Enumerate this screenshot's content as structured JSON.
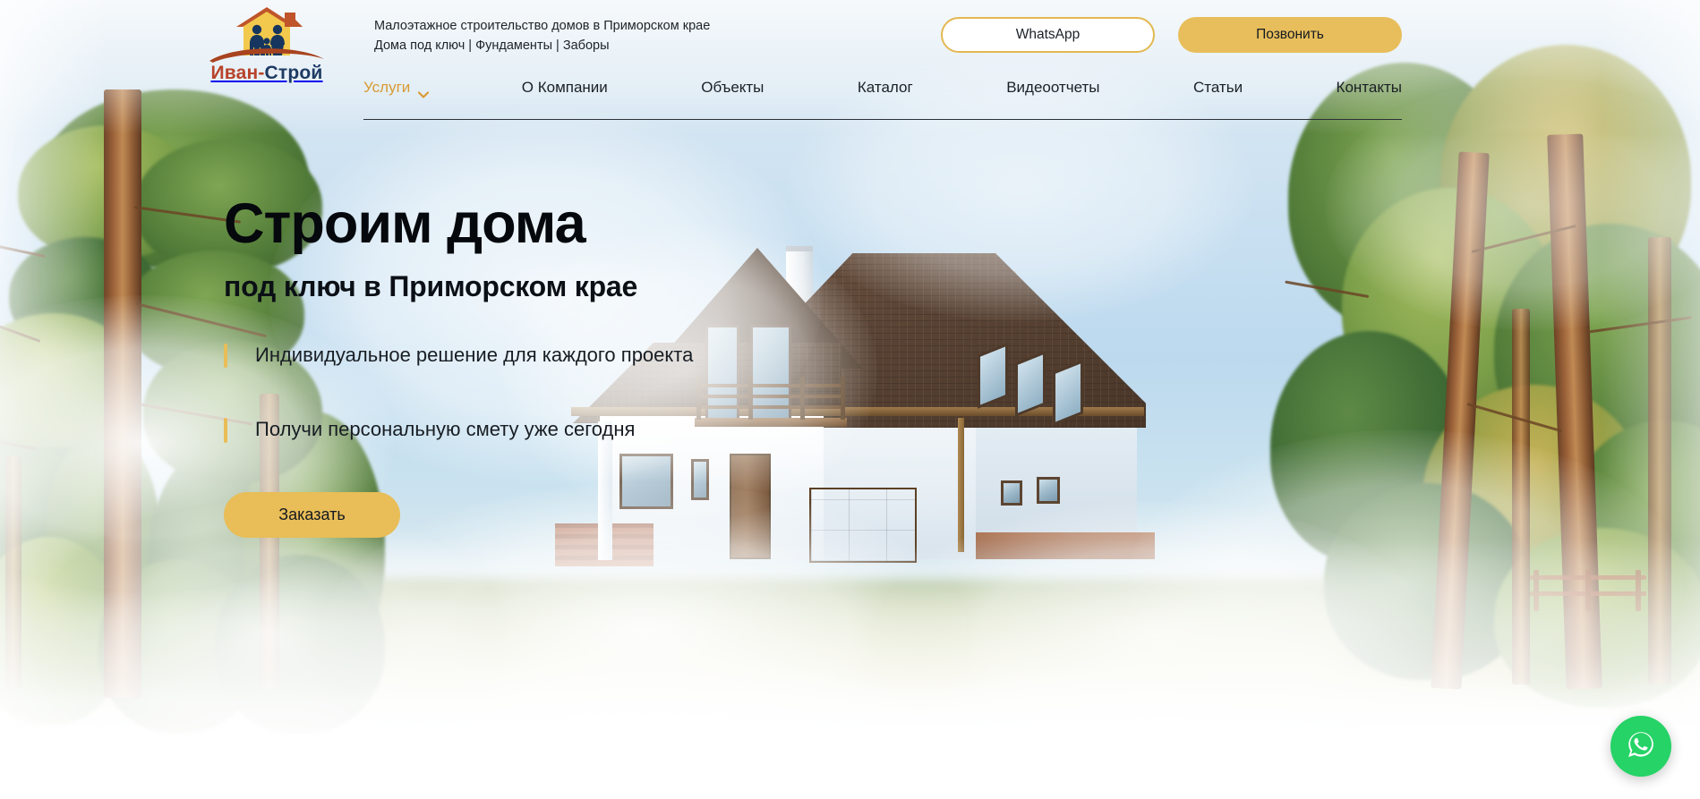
{
  "site": {
    "logo": {
      "icon": "house-family-logo-icon",
      "word_part1": "Иван",
      "word_sep": "-",
      "word_part2": "Строй"
    },
    "tagline_line1": "Малоэтажное строительство домов в Приморском крае",
    "tagline_line2": "Дома под ключ | Фундаменты | Заборы"
  },
  "header": {
    "whatsapp_button": "WhatsApp",
    "call_button": "Позвонить",
    "nav": [
      {
        "label": "Услуги",
        "active": true,
        "has_dropdown": true,
        "icon": "chevron-down-icon"
      },
      {
        "label": "О Компании",
        "active": false,
        "has_dropdown": false
      },
      {
        "label": "Объекты",
        "active": false,
        "has_dropdown": false
      },
      {
        "label": "Каталог",
        "active": false,
        "has_dropdown": false
      },
      {
        "label": "Видеоотчеты",
        "active": false,
        "has_dropdown": false
      },
      {
        "label": "Статьи",
        "active": false,
        "has_dropdown": false
      },
      {
        "label": "Контакты",
        "active": false,
        "has_dropdown": false
      }
    ]
  },
  "hero": {
    "title": "Строим дома",
    "subtitle": "под ключ в Приморском крае",
    "bullets": [
      "Индивидуальное решение для каждого проекта",
      "Получи персональную смету уже сегодня"
    ],
    "cta_button": "Заказать"
  },
  "floating": {
    "whatsapp_icon": "whatsapp-icon",
    "whatsapp_label": "WhatsApp"
  },
  "colors": {
    "accent_gold": "#E8BE5C",
    "accent_gold_bullet": "#E9BD57",
    "nav_active": "#D99A33",
    "logo_red": "#B8432A",
    "logo_navy": "#1D3A63",
    "whatsapp_green": "#25D366",
    "text_dark": "#1B2026"
  },
  "background": {
    "scene": "pine-forest-with-white-two-story-house-render",
    "sky": "#C9E0F1"
  }
}
